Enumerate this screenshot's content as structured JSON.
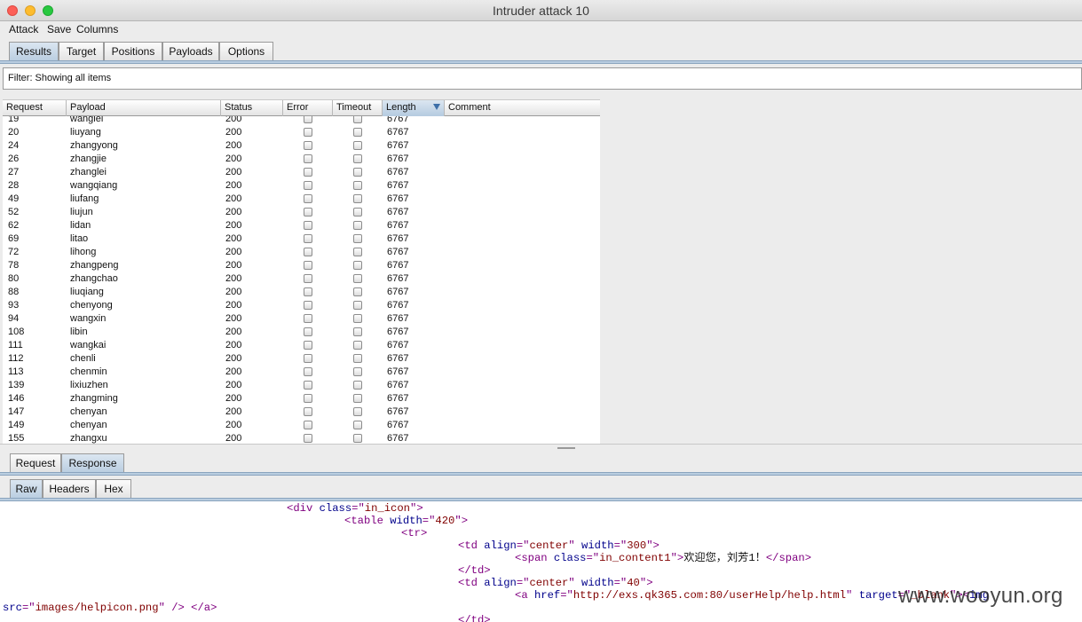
{
  "window": {
    "title": "Intruder attack 10"
  },
  "menu": [
    "Attack",
    "Save",
    "Columns"
  ],
  "main_tabs": [
    {
      "label": "Results",
      "selected": true
    },
    {
      "label": "Target",
      "selected": false
    },
    {
      "label": "Positions",
      "selected": false
    },
    {
      "label": "Payloads",
      "selected": false
    },
    {
      "label": "Options",
      "selected": false
    }
  ],
  "filter": {
    "text": "Filter: Showing all items"
  },
  "table": {
    "columns": [
      "Request",
      "Payload",
      "Status",
      "Error",
      "Timeout",
      "Length",
      "Comment"
    ],
    "sorted_column": "Length",
    "rows": [
      [
        "19",
        "wanglei",
        "200",
        "6767"
      ],
      [
        "20",
        "liuyang",
        "200",
        "6767"
      ],
      [
        "24",
        "zhangyong",
        "200",
        "6767"
      ],
      [
        "26",
        "zhangjie",
        "200",
        "6767"
      ],
      [
        "27",
        "zhanglei",
        "200",
        "6767"
      ],
      [
        "28",
        "wangqiang",
        "200",
        "6767"
      ],
      [
        "49",
        "liufang",
        "200",
        "6767"
      ],
      [
        "52",
        "liujun",
        "200",
        "6767"
      ],
      [
        "62",
        "lidan",
        "200",
        "6767"
      ],
      [
        "69",
        "litao",
        "200",
        "6767"
      ],
      [
        "72",
        "lihong",
        "200",
        "6767"
      ],
      [
        "78",
        "zhangpeng",
        "200",
        "6767"
      ],
      [
        "80",
        "zhangchao",
        "200",
        "6767"
      ],
      [
        "88",
        "liuqiang",
        "200",
        "6767"
      ],
      [
        "93",
        "chenyong",
        "200",
        "6767"
      ],
      [
        "94",
        "wangxin",
        "200",
        "6767"
      ],
      [
        "108",
        "libin",
        "200",
        "6767"
      ],
      [
        "111",
        "wangkai",
        "200",
        "6767"
      ],
      [
        "112",
        "chenli",
        "200",
        "6767"
      ],
      [
        "113",
        "chenmin",
        "200",
        "6767"
      ],
      [
        "139",
        "lixiuzhen",
        "200",
        "6767"
      ],
      [
        "146",
        "zhangming",
        "200",
        "6767"
      ],
      [
        "147",
        "chenyan",
        "200",
        "6767"
      ],
      [
        "149",
        "chenyan",
        "200",
        "6767"
      ],
      [
        "155",
        "zhangxu",
        "200",
        "6767"
      ]
    ]
  },
  "message_tabs": [
    {
      "label": "Request",
      "selected": false
    },
    {
      "label": "Response",
      "selected": true
    }
  ],
  "view_tabs": [
    {
      "label": "Raw",
      "selected": true
    },
    {
      "label": "Headers",
      "selected": false
    },
    {
      "label": "Hex",
      "selected": false
    }
  ],
  "response_lines": [
    [
      [
        "tag",
        "<div "
      ],
      [
        "attr",
        "class"
      ],
      [
        "tag",
        "=\""
      ],
      [
        "val",
        "in_icon"
      ],
      [
        "tag",
        "\">"
      ]
    ],
    [
      [
        "tag",
        "<table "
      ],
      [
        "attr",
        "width"
      ],
      [
        "tag",
        "=\""
      ],
      [
        "val",
        "420"
      ],
      [
        "tag",
        "\">"
      ]
    ],
    [
      [
        "tag",
        "<tr>"
      ]
    ],
    [
      [
        "tag",
        "<td "
      ],
      [
        "attr",
        "align"
      ],
      [
        "tag",
        "=\""
      ],
      [
        "val",
        "center"
      ],
      [
        "tag",
        "\" "
      ],
      [
        "attr",
        "width"
      ],
      [
        "tag",
        "=\""
      ],
      [
        "val",
        "300"
      ],
      [
        "tag",
        "\">"
      ]
    ],
    [
      [
        "tag",
        "<span "
      ],
      [
        "attr",
        "class"
      ],
      [
        "tag",
        "=\""
      ],
      [
        "val",
        "in_content1"
      ],
      [
        "tag",
        "\">"
      ],
      [
        "txt",
        "欢迎您，刘芳1！"
      ],
      [
        "tag",
        "</span>"
      ]
    ],
    [
      [
        "tag",
        "</td>"
      ]
    ],
    [
      [
        "tag",
        "<td "
      ],
      [
        "attr",
        "align"
      ],
      [
        "tag",
        "=\""
      ],
      [
        "val",
        "center"
      ],
      [
        "tag",
        "\" "
      ],
      [
        "attr",
        "width"
      ],
      [
        "tag",
        "=\""
      ],
      [
        "val",
        "40"
      ],
      [
        "tag",
        "\">"
      ]
    ],
    [
      [
        "tag",
        "<a "
      ],
      [
        "attr",
        "href"
      ],
      [
        "tag",
        "=\""
      ],
      [
        "val",
        "http://exs.qk365.com:80/userHelp/help.html"
      ],
      [
        "tag",
        "\" "
      ],
      [
        "attr",
        "target"
      ],
      [
        "tag",
        "=\""
      ],
      [
        "val",
        "_blank"
      ],
      [
        "tag",
        "\"><"
      ],
      [
        "attr",
        "img"
      ]
    ],
    [
      [
        "attr",
        "src"
      ],
      [
        "tag",
        "=\""
      ],
      [
        "val",
        "images/helpicon.png"
      ],
      [
        "tag",
        "\" /> </a>"
      ]
    ],
    [
      [
        "tag",
        "</td>"
      ]
    ]
  ],
  "watermark": "www.wooyun.org"
}
